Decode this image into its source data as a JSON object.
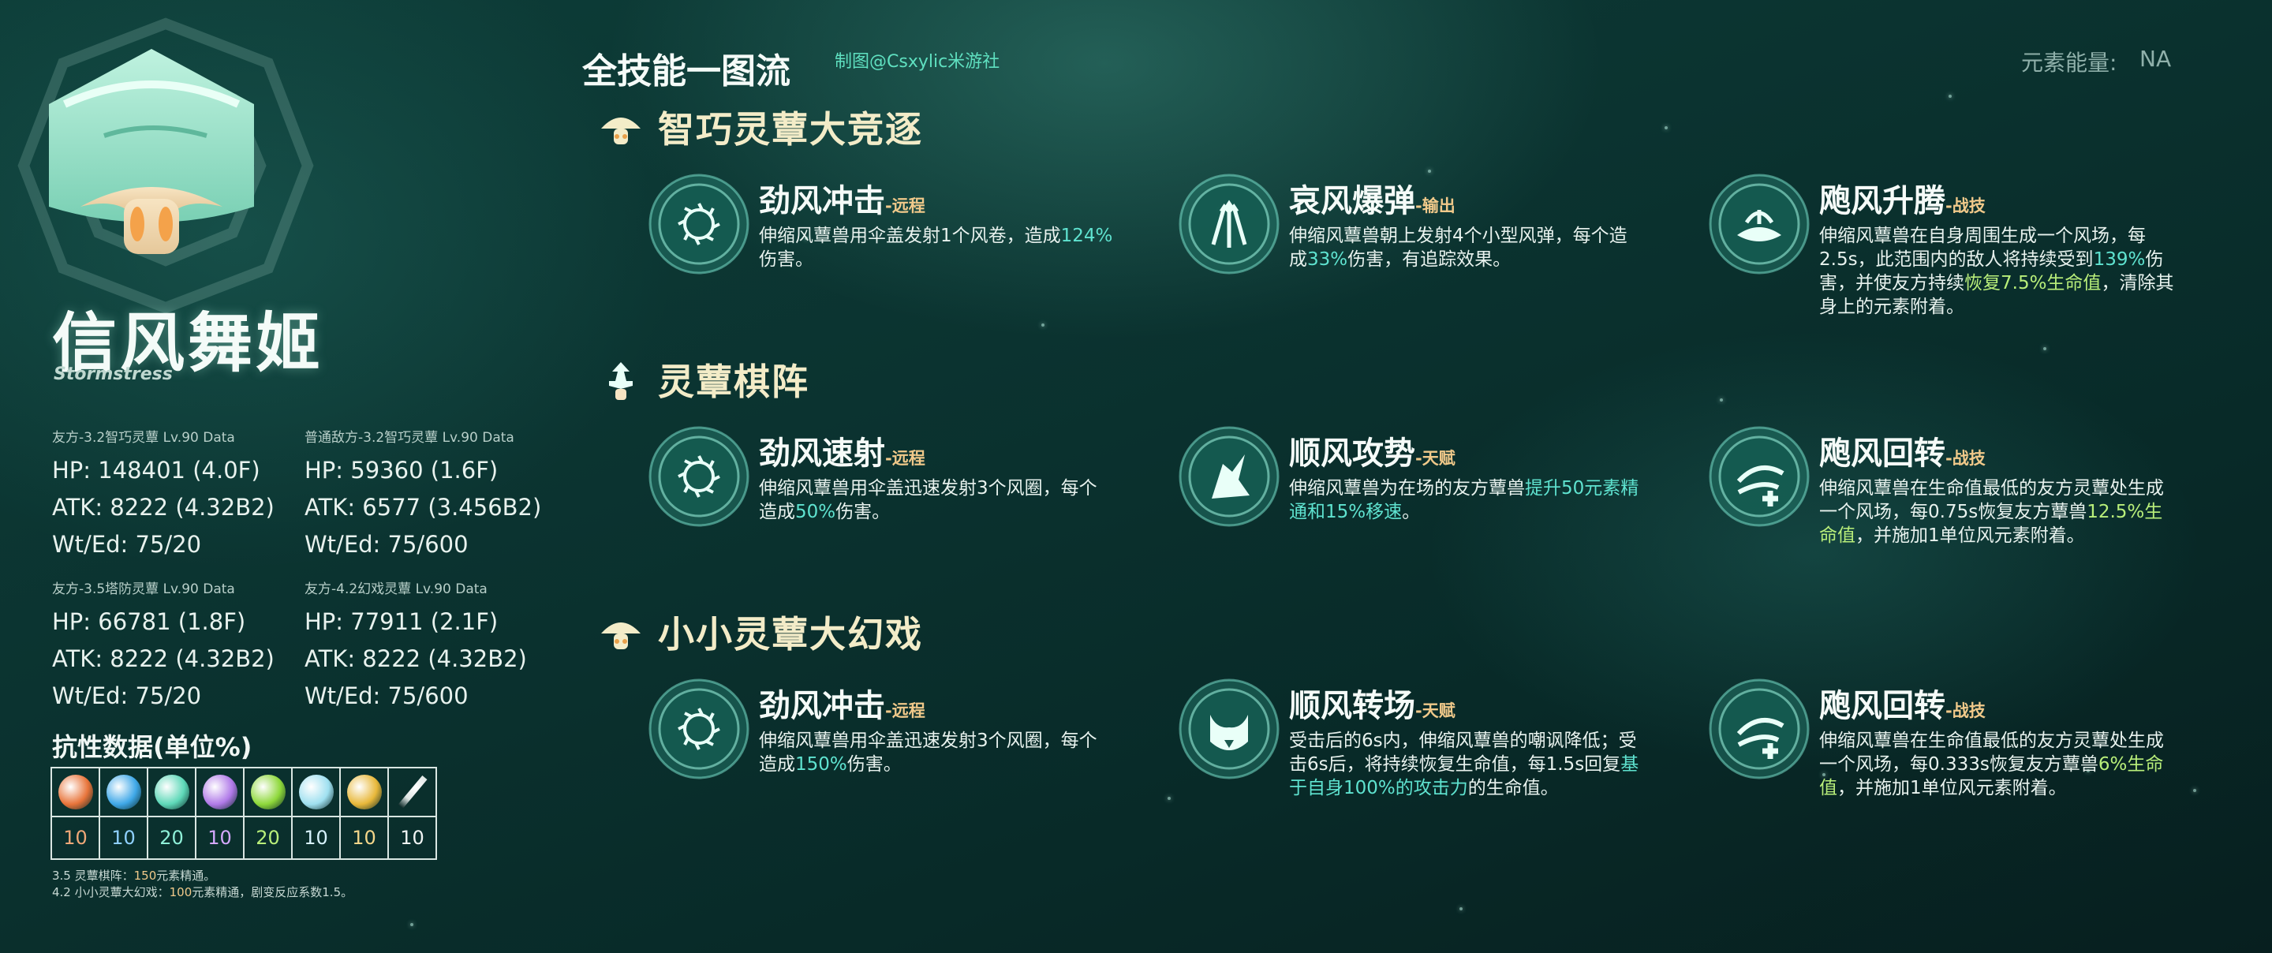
{
  "colors": {
    "accent_cyan": "#5fe3d0",
    "accent_green": "#b9ef7a",
    "tag_gold": "#f0c98a",
    "section_title": "#f3ecc8"
  },
  "header": {
    "title": "全技能一图流",
    "credit": "制图@Csxylic米游社",
    "energy_label": "元素能量:",
    "energy_value": "NA"
  },
  "character": {
    "name": "信风舞姬",
    "subtitle": "Stormstress",
    "portrait_icon": "mushroom-portrait"
  },
  "stats": [
    {
      "header": "友方-3.2智巧灵蕈 Lv.90 Data",
      "hp": "HP: 148401 (4.0F)",
      "atk": "ATK: 8222 (4.32B2)",
      "wt": "Wt/Ed: 75/20"
    },
    {
      "header": "普通敌方-3.2智巧灵蕈 Lv.90 Data",
      "hp": "HP: 59360 (1.6F)",
      "atk": "ATK: 6577 (3.456B2)",
      "wt": "Wt/Ed: 75/600"
    },
    {
      "header": "友方-3.5塔防灵蕈 Lv.90 Data",
      "hp": "HP: 66781 (1.8F)",
      "atk": "ATK: 8222 (4.32B2)",
      "wt": "Wt/Ed: 75/20"
    },
    {
      "header": "友方-4.2幻戏灵蕈 Lv.90 Data",
      "hp": "HP: 77911 (2.1F)",
      "atk": "ATK: 8222 (4.32B2)",
      "wt": "Wt/Ed: 75/600"
    }
  ],
  "resistance": {
    "title": "抗性数据(单位%)",
    "items": [
      {
        "icon": "pyro-icon",
        "color": "#e8743a",
        "value": "10",
        "value_color": "#f0a878"
      },
      {
        "icon": "hydro-icon",
        "color": "#3fa8e8",
        "value": "10",
        "value_color": "#8fd0ff"
      },
      {
        "icon": "anemo-icon",
        "color": "#5ed8b8",
        "value": "20",
        "value_color": "#8ff0d8"
      },
      {
        "icon": "electro-icon",
        "color": "#b07ae8",
        "value": "10",
        "value_color": "#d4a8ff"
      },
      {
        "icon": "dendro-icon",
        "color": "#8ed83a",
        "value": "20",
        "value_color": "#b9ef7a"
      },
      {
        "icon": "cryo-icon",
        "color": "#9fe0f0",
        "value": "10",
        "value_color": "#d8f4ff"
      },
      {
        "icon": "geo-icon",
        "color": "#e8b83a",
        "value": "10",
        "value_color": "#f4d68a"
      },
      {
        "icon": "physical-sword-icon",
        "color": "#dfe6e4",
        "value": "10",
        "value_color": "#f0f4f3"
      }
    ]
  },
  "notes": [
    {
      "pre": "3.5 灵蕈棋阵：",
      "hl": "150",
      "post": "元素精通。"
    },
    {
      "pre": "4.2 小小灵蕈大幻戏：",
      "hl": "100",
      "post": "元素精通，剧变反应系数1.5。"
    }
  ],
  "sections": [
    {
      "title": "智巧灵蕈大竞逐",
      "icon": "mushroom-section-icon",
      "skills": [
        {
          "icon": "wind-ring-icon",
          "name": "劲风冲击",
          "tag": "-远程",
          "desc": [
            {
              "t": "伸缩风蕈兽用伞盖发射1个风卷，造成"
            },
            {
              "t": "124%",
              "c": "cy"
            },
            {
              "t": "伤害。"
            }
          ]
        },
        {
          "icon": "wind-bolts-icon",
          "name": "哀风爆弹",
          "tag": "-输出",
          "desc": [
            {
              "t": "伸缩风蕈兽朝上发射4个小型风弹，每个造成"
            },
            {
              "t": "33%",
              "c": "cy"
            },
            {
              "t": "伤害，有追踪效果。"
            }
          ]
        },
        {
          "icon": "wind-rise-icon",
          "name": "飑风升腾",
          "tag": "-战技",
          "desc": [
            {
              "t": "伸缩风蕈兽在自身周围生成一个风场，每2.5s，此范围内的敌人将持续受到"
            },
            {
              "t": "139%",
              "c": "cy"
            },
            {
              "t": "伤害，并使友方持续"
            },
            {
              "t": "恢复7.5%生命值",
              "c": "gr"
            },
            {
              "t": "，清除其身上的元素附着。"
            }
          ]
        }
      ]
    },
    {
      "title": "灵蕈棋阵",
      "icon": "chess-section-icon",
      "skills": [
        {
          "icon": "wind-ring-icon",
          "name": "劲风速射",
          "tag": "-远程",
          "desc": [
            {
              "t": "伸缩风蕈兽用伞盖迅速发射3个风圈，每个造成"
            },
            {
              "t": "50%",
              "c": "cy"
            },
            {
              "t": "伤害。"
            }
          ]
        },
        {
          "icon": "wind-trend-icon",
          "name": "顺风攻势",
          "tag": "-天赋",
          "desc": [
            {
              "t": "伸缩风蕈兽为在场的友方蕈兽"
            },
            {
              "t": "提升50元素精通和15%移速",
              "c": "cy"
            },
            {
              "t": "。"
            }
          ]
        },
        {
          "icon": "wind-heal-icon",
          "name": "飑风回转",
          "tag": "-战技",
          "desc": [
            {
              "t": "伸缩风蕈兽在生命值最低的友方灵蕈处生成一个风场，每0.75s恢复友方蕈兽"
            },
            {
              "t": "12.5%生命值",
              "c": "gr"
            },
            {
              "t": "，并施加1单位风元素附着。"
            }
          ]
        }
      ]
    },
    {
      "title": "小小灵蕈大幻戏",
      "icon": "mushroom-section-icon",
      "skills": [
        {
          "icon": "wind-ring-icon",
          "name": "劲风冲击",
          "tag": "-远程",
          "desc": [
            {
              "t": "伸缩风蕈兽用伞盖迅速发射3个风圈，每个造成"
            },
            {
              "t": "150%",
              "c": "cy"
            },
            {
              "t": "伤害。"
            }
          ]
        },
        {
          "icon": "wind-shift-icon",
          "name": "顺风转场",
          "tag": "-天赋",
          "desc": [
            {
              "t": "受击后的6s内，伸缩风蕈兽的嘲讽降低；受击6s后，将持续恢复生命值，每1.5s回复"
            },
            {
              "t": "基于自身100%的攻击力",
              "c": "cy"
            },
            {
              "t": "的生命值。"
            }
          ]
        },
        {
          "icon": "wind-heal-icon",
          "name": "飑风回转",
          "tag": "-战技",
          "desc": [
            {
              "t": "伸缩风蕈兽在生命值最低的友方灵蕈处生成一个风场，每0.333s恢复友方蕈兽"
            },
            {
              "t": "6%生命值",
              "c": "gr"
            },
            {
              "t": "，并施加1单位风元素附着。"
            }
          ]
        }
      ]
    }
  ]
}
